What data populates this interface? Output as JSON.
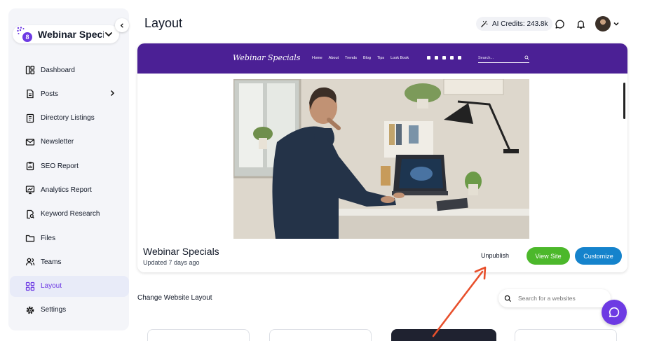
{
  "sidebar": {
    "workspace_name": "Webinar Specials",
    "workspace_badge": "8",
    "items": [
      {
        "label": "Dashboard"
      },
      {
        "label": "Posts"
      },
      {
        "label": "Directory Listings"
      },
      {
        "label": "Newsletter"
      },
      {
        "label": "SEO Report"
      },
      {
        "label": "Analytics Report"
      },
      {
        "label": "Keyword Research"
      },
      {
        "label": "Files"
      },
      {
        "label": "Teams"
      },
      {
        "label": "Layout"
      },
      {
        "label": "Settings"
      }
    ],
    "active_item": "Layout"
  },
  "header": {
    "title": "Layout",
    "credits": "AI Credits: 243.8k"
  },
  "site_card": {
    "preview": {
      "brand": "Webinar Specials",
      "links": [
        "Home",
        "About",
        "Trends",
        "Blog",
        "Tips",
        "Look Book"
      ],
      "search_placeholder": "Search..."
    },
    "name": "Webinar Specials",
    "updated": "Updated 7 days ago",
    "unpublish_label": "Unpublish",
    "view_site_label": "View Site",
    "customize_label": "Customize"
  },
  "layouts": {
    "title": "Change Website Layout",
    "search_placeholder": "Search for a websites"
  },
  "colors": {
    "accent": "#6d3ae3",
    "preview_nav": "#4b2095",
    "view_site": "#4cb82b",
    "customize": "#1583cc",
    "annotation_arrow": "#e8502c"
  }
}
